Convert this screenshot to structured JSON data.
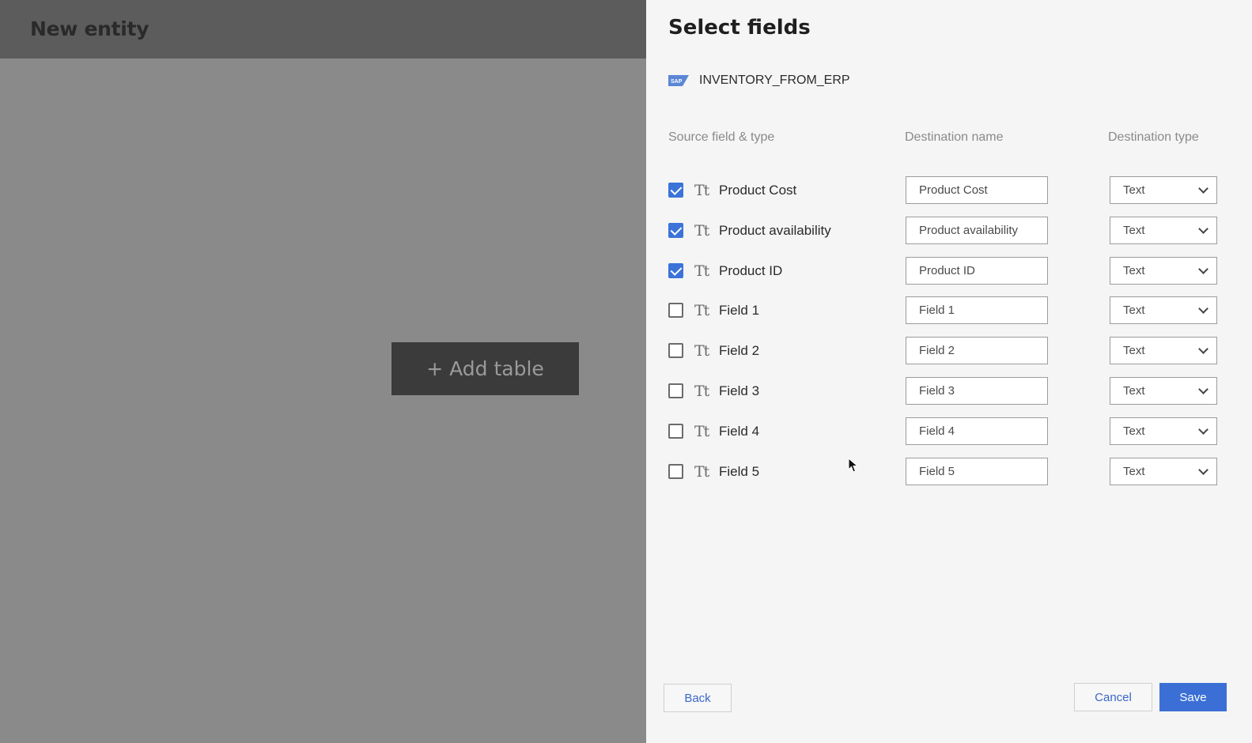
{
  "background_app": {
    "title": "New entity",
    "add_table_label": "+ Add table"
  },
  "panel": {
    "title": "Select fields",
    "source_icon": "sap-icon",
    "source_name": "INVENTORY_FROM_ERP",
    "columns": {
      "source": "Source field & type",
      "destination_name": "Destination name",
      "destination_type": "Destination type"
    },
    "fields": [
      {
        "checked": true,
        "type_icon": "text-type-icon",
        "name": "Product Cost",
        "dest_name": "Product Cost",
        "dest_type": "Text"
      },
      {
        "checked": true,
        "type_icon": "text-type-icon",
        "name": "Product availability",
        "dest_name": "Product availability",
        "dest_type": "Text"
      },
      {
        "checked": true,
        "type_icon": "text-type-icon",
        "name": "Product ID",
        "dest_name": "Product ID",
        "dest_type": "Text"
      },
      {
        "checked": false,
        "type_icon": "text-type-icon",
        "name": "Field 1",
        "dest_name": "Field 1",
        "dest_type": "Text"
      },
      {
        "checked": false,
        "type_icon": "text-type-icon",
        "name": "Field 2",
        "dest_name": "Field 2",
        "dest_type": "Text"
      },
      {
        "checked": false,
        "type_icon": "text-type-icon",
        "name": "Field 3",
        "dest_name": "Field 3",
        "dest_type": "Text"
      },
      {
        "checked": false,
        "type_icon": "text-type-icon",
        "name": "Field 4",
        "dest_name": "Field 4",
        "dest_type": "Text"
      },
      {
        "checked": false,
        "type_icon": "text-type-icon",
        "name": "Field 5",
        "dest_name": "Field 5",
        "dest_type": "Text"
      }
    ],
    "type_icon_glyph": "Tt",
    "buttons": {
      "back": "Back",
      "cancel": "Cancel",
      "save": "Save"
    }
  },
  "colors": {
    "accent": "#3b6fd6",
    "checkbox_on": "#3b73d9",
    "overlay": "#8a8a8a"
  }
}
